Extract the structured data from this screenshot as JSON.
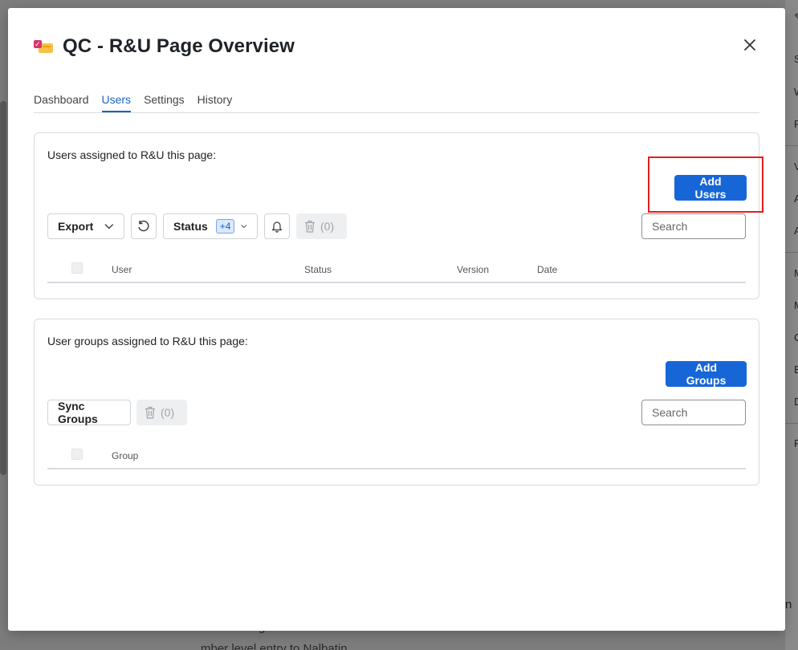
{
  "modal": {
    "title": "QC - R&U Page Overview",
    "tabs": [
      {
        "label": "Dashboard",
        "active": false
      },
      {
        "label": "Users",
        "active": true
      },
      {
        "label": "Settings",
        "active": false
      },
      {
        "label": "History",
        "active": false
      }
    ]
  },
  "users_section": {
    "label": "Users assigned to R&U this page:",
    "add_button": "Add Users",
    "export_label": "Export",
    "status_label": "Status",
    "status_badge": "+4",
    "delete_count": "(0)",
    "search_placeholder": "Search",
    "columns": [
      "User",
      "Status",
      "Version",
      "Date"
    ]
  },
  "groups_section": {
    "label": "User groups assigned to R&U this page:",
    "add_button": "Add Groups",
    "sync_label": "Sync Groups",
    "delete_count": "(0)",
    "search_placeholder": "Search",
    "columns": [
      "Group"
    ]
  },
  "background": {
    "right_letters": [
      "S",
      "W",
      "P",
      "V",
      "A",
      "A",
      "M",
      "M",
      "C",
      "E",
      "D",
      "R"
    ],
    "bottom_text_1": "g",
    "bottom_text_2": "mber level entry to Nalbatin",
    "right_text": "n"
  },
  "colors": {
    "primary": "#1766d8",
    "highlight": "#e0201b",
    "tab_active": "#1a62c4"
  }
}
